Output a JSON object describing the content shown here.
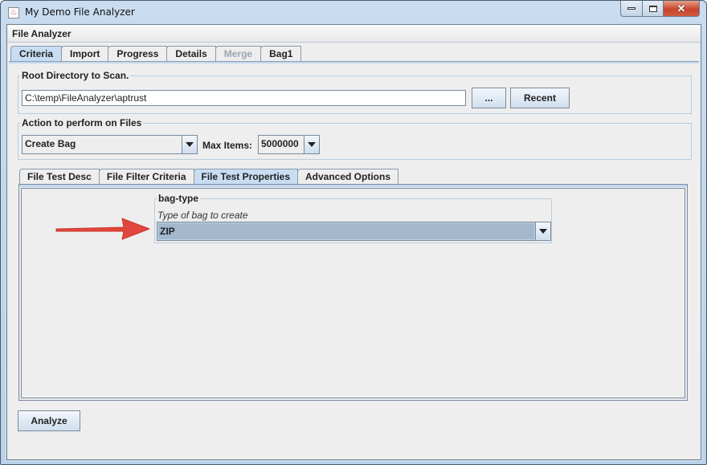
{
  "window": {
    "title": "My Demo File Analyzer",
    "icon": "java-cup-icon",
    "controls": {
      "minimize": "minimize-icon",
      "maximize": "maximize-icon",
      "close": "✕"
    }
  },
  "menubar": {
    "title": "File Analyzer"
  },
  "tabs": [
    {
      "label": "Criteria",
      "state": "active"
    },
    {
      "label": "Import",
      "state": "normal"
    },
    {
      "label": "Progress",
      "state": "normal"
    },
    {
      "label": "Details",
      "state": "normal"
    },
    {
      "label": "Merge",
      "state": "disabled"
    },
    {
      "label": "Bag1",
      "state": "normal"
    }
  ],
  "root_directory": {
    "group_title": "Root Directory to Scan.",
    "path_value": "C:\\temp\\FileAnalyzer\\aptrust",
    "browse_label": "...",
    "recent_label": "Recent"
  },
  "action": {
    "group_title": "Action to perform on Files",
    "selected_action": "Create Bag",
    "max_items_label": "Max Items:",
    "max_items_value": "5000000"
  },
  "subtabs": [
    {
      "label": "File Test Desc",
      "state": "normal"
    },
    {
      "label": "File Filter Criteria",
      "state": "normal"
    },
    {
      "label": "File Test Properties",
      "state": "active"
    },
    {
      "label": "Advanced Options",
      "state": "normal"
    }
  ],
  "property": {
    "name": "bag-type",
    "description": "Type of bag to create",
    "selected_value": "ZIP"
  },
  "annotation": {
    "arrow_color": "#e2463c"
  },
  "footer": {
    "analyze_label": "Analyze"
  }
}
